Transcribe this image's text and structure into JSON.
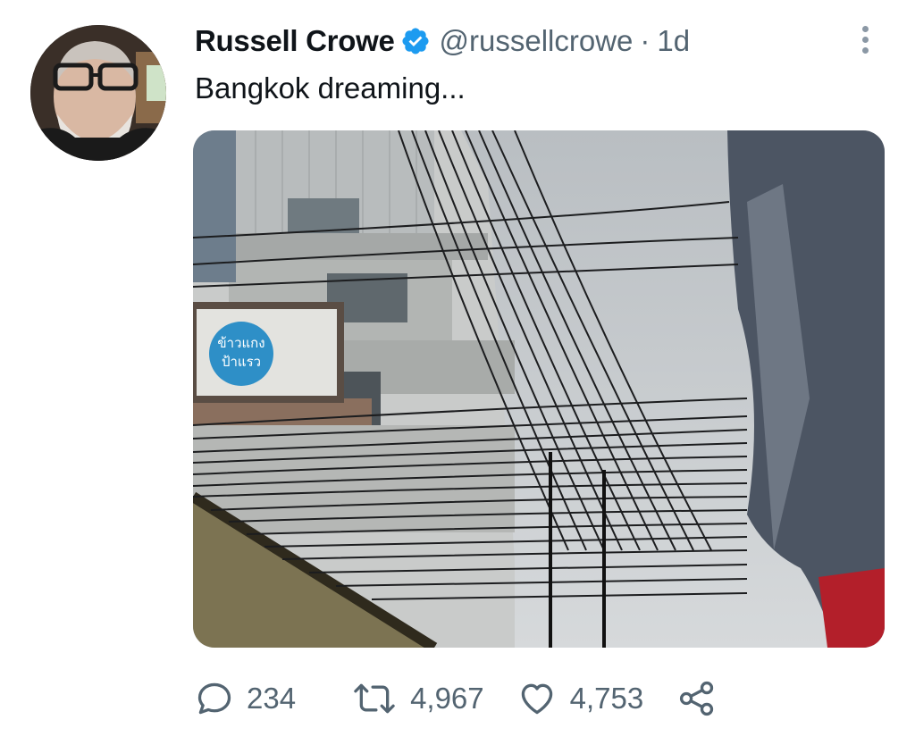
{
  "author": {
    "name": "Russell Crowe",
    "handle": "@russellcrowe",
    "separator": "·",
    "time": "1d",
    "verified": true
  },
  "tweet": {
    "text": "Bangkok dreaming..."
  },
  "media": {
    "sign_line1": "ข้าวแกง",
    "sign_line2": "ป้าแรว"
  },
  "actions": {
    "replies": "234",
    "retweets": "4,967",
    "likes": "4,753"
  },
  "colors": {
    "verified_blue": "#1d9bf0",
    "text_primary": "#0f1419",
    "text_secondary": "#536471"
  },
  "icons": [
    "verified-badge-icon",
    "more-options-icon",
    "reply-icon",
    "retweet-icon",
    "like-icon",
    "share-icon"
  ]
}
